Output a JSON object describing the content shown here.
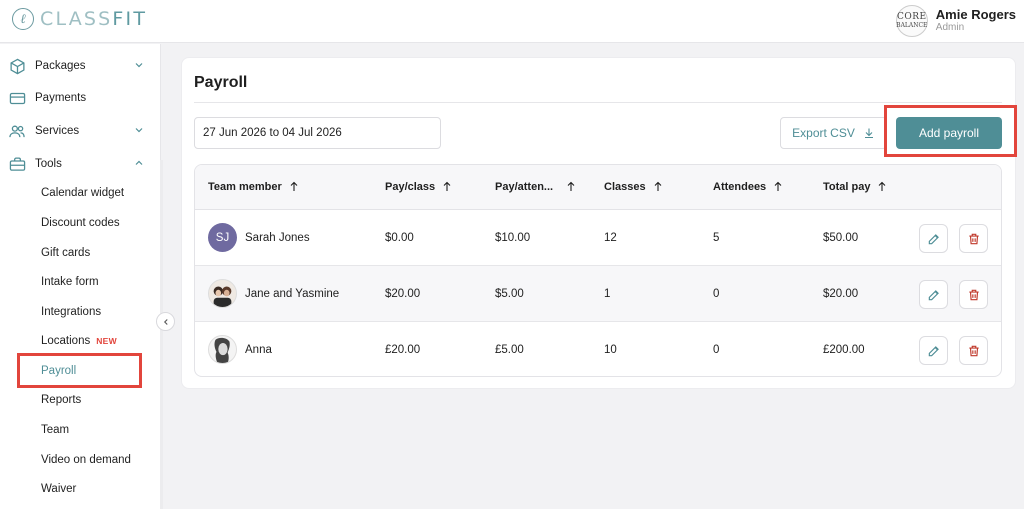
{
  "brand": {
    "logo_mark": "ℓ",
    "name_a": "CLASS",
    "name_b": "FIT"
  },
  "user": {
    "name": "Amie Rogers",
    "role": "Admin",
    "avatar_line1": "CORE",
    "avatar_line2": "BALANCE"
  },
  "sidebar": {
    "items": [
      {
        "label": "Packages",
        "icon": "box-icon",
        "chevron": "down"
      },
      {
        "label": "Payments",
        "icon": "card-icon"
      },
      {
        "label": "Services",
        "icon": "users-icon",
        "chevron": "down"
      },
      {
        "label": "Tools",
        "icon": "briefcase-icon",
        "chevron": "up"
      }
    ],
    "tools_sub": [
      {
        "label": "Calendar widget"
      },
      {
        "label": "Discount codes"
      },
      {
        "label": "Gift cards"
      },
      {
        "label": "Intake form"
      },
      {
        "label": "Integrations"
      },
      {
        "label": "Locations",
        "badge": "NEW"
      },
      {
        "label": "Payroll",
        "active": true
      },
      {
        "label": "Reports"
      },
      {
        "label": "Team"
      },
      {
        "label": "Video on demand"
      },
      {
        "label": "Waiver"
      }
    ]
  },
  "page": {
    "title": "Payroll",
    "date_range": "27 Jun 2026 to 04 Jul 2026",
    "export_label": "Export CSV",
    "add_label": "Add payroll"
  },
  "table": {
    "headers": [
      "Team member",
      "Pay/class",
      "Pay/atten...",
      "Classes",
      "Attendees",
      "Total pay"
    ],
    "rows": [
      {
        "initials": "SJ",
        "name": "Sarah Jones",
        "pay_class": "$0.00",
        "pay_att": "$10.00",
        "classes": "12",
        "attendees": "5",
        "total": "$50.00"
      },
      {
        "initials": "",
        "name": "Jane and Yasmine",
        "pay_class": "$20.00",
        "pay_att": "$5.00",
        "classes": "1",
        "attendees": "0",
        "total": "$20.00"
      },
      {
        "initials": "",
        "name": "Anna",
        "pay_class": "£20.00",
        "pay_att": "£5.00",
        "classes": "10",
        "attendees": "0",
        "total": "£200.00"
      }
    ]
  },
  "colors": {
    "accent": "#4f8e96",
    "highlight": "#e2453c",
    "danger": "#c0392b"
  }
}
